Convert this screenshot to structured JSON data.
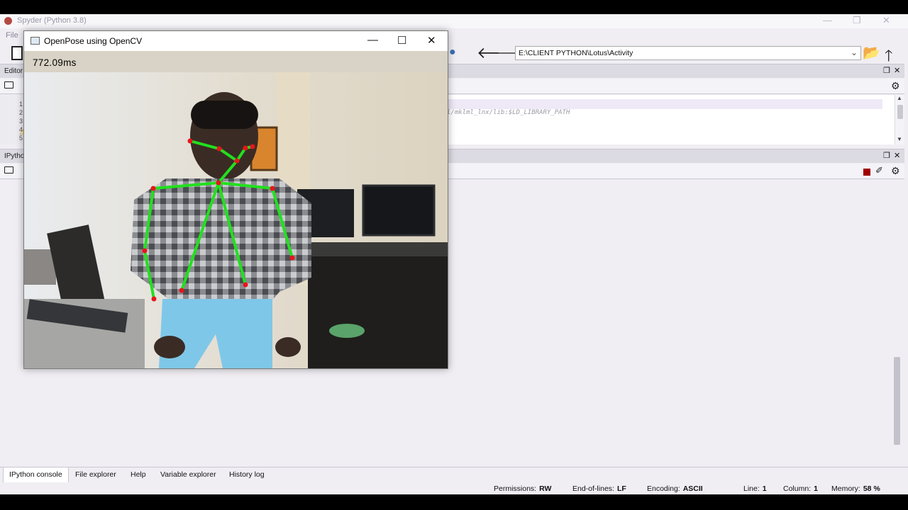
{
  "spyder": {
    "title": "Spyder (Python 3.8)",
    "menu_first": "File",
    "path": "E:\\CLIENT PYTHON\\Lotus\\Activity",
    "editor_label": "Editor",
    "editor_lines": [
      "1",
      "2",
      "3",
      "4",
      "5"
    ],
    "editor_code": "l/mklml_lnx/lib:$LD_LIBRARY_PATH",
    "console_label": "IPython",
    "bottom_tabs": [
      "IPython console",
      "File explorer",
      "Help",
      "Variable explorer",
      "History log"
    ],
    "status": {
      "permissions_label": "Permissions:",
      "permissions_value": "RW",
      "eol_label": "End-of-lines:",
      "eol_value": "LF",
      "encoding_label": "Encoding:",
      "encoding_value": "ASCII",
      "line_label": "Line:",
      "line_value": "1",
      "column_label": "Column:",
      "column_value": "1",
      "memory_label": "Memory:",
      "memory_value": "58 %"
    }
  },
  "cv_window": {
    "title": "OpenPose using OpenCV",
    "latency": "772.09ms"
  },
  "icons": {
    "back": "arrow-left-icon",
    "forward": "arrow-right-icon",
    "open_folder": "folder-open-icon",
    "up": "arrow-up-icon",
    "python": "python-icon",
    "settings": "gear-icon",
    "stop": "stop-icon",
    "clear": "eraser-icon",
    "warning": "warning-icon",
    "minimize": "minimize-icon",
    "maximize": "maximize-icon",
    "close": "close-icon"
  },
  "colors": {
    "skeleton_line": "#22e01e",
    "skeleton_joint": "#e8141c",
    "stop": "#a00000"
  }
}
